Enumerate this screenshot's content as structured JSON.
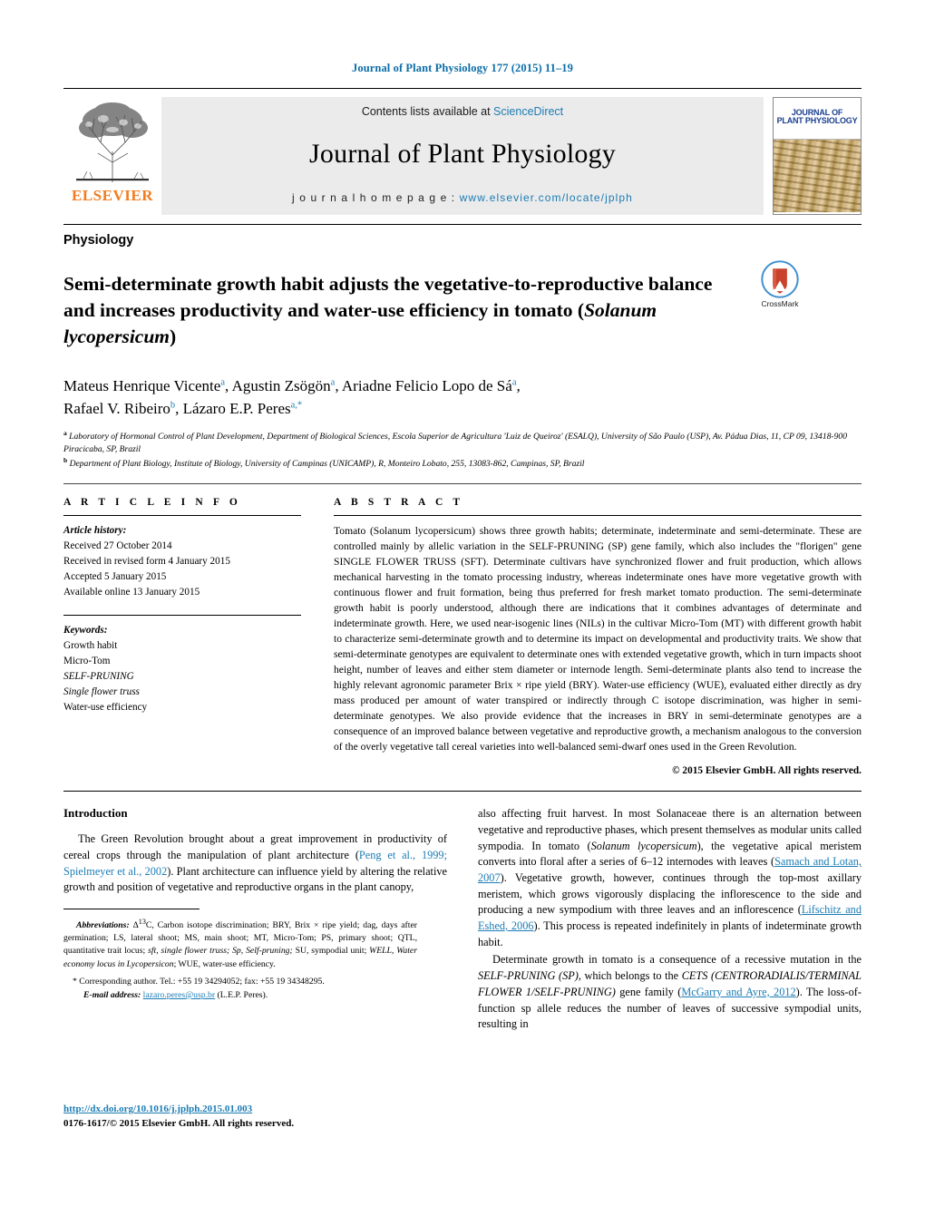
{
  "running_head": "Journal of Plant Physiology 177 (2015) 11–19",
  "masthead": {
    "contents_prefix": "Contents lists available at ",
    "sciencedirect": "ScienceDirect",
    "journal_name": "Journal of Plant Physiology",
    "homepage_prefix": "j o u r n a l   h o m e p a g e :   ",
    "homepage_url": "www.elsevier.com/locate/jplph",
    "publisher": "ELSEVIER",
    "cover_title_line1": "JOURNAL OF",
    "cover_title_line2": "PLANT PHYSIOLOGY"
  },
  "article": {
    "section_label": "Physiology",
    "title_part1": "Semi-determinate growth habit adjusts the vegetative-to-reproductive balance and increases productivity and water-use efficiency in tomato (",
    "title_italic": "Solanum lycopersicum",
    "title_part2": ")",
    "crossmark_label": "CrossMark",
    "authors": "Mateus Henrique Vicente a, Agustin Zsögön a, Ariadne Felicio Lopo de Sá a, Rafael V. Ribeiro b, Lázaro E.P. Peres a,*",
    "affiliation_a": "Laboratory of Hormonal Control of Plant Development, Department of Biological Sciences, Escola Superior de Agricultura 'Luiz de Queiroz' (ESALQ), University of São Paulo (USP), Av. Pádua Dias, 11, CP 09, 13418-900 Piracicaba, SP, Brazil",
    "affiliation_b": "Department of Plant Biology, Institute of Biology, University of Campinas (UNICAMP), R, Monteiro Lobato, 255, 13083-862, Campinas, SP, Brazil"
  },
  "article_info": {
    "heading": "A R T I C L E   I N F O",
    "history_label": "Article history:",
    "history": [
      "Received 27 October 2014",
      "Received in revised form 4 January 2015",
      "Accepted 5 January 2015",
      "Available online 13 January 2015"
    ],
    "keywords_label": "Keywords:",
    "keywords": [
      "Growth habit",
      "Micro-Tom",
      "SELF-PRUNING",
      "Single flower truss",
      "Water-use efficiency"
    ]
  },
  "abstract": {
    "heading": "A B S T R A C T",
    "text": "Tomato (Solanum lycopersicum) shows three growth habits; determinate, indeterminate and semi-determinate. These are controlled mainly by allelic variation in the SELF-PRUNING (SP) gene family, which also includes the \"florigen\" gene SINGLE FLOWER TRUSS (SFT). Determinate cultivars have synchronized flower and fruit production, which allows mechanical harvesting in the tomato processing industry, whereas indeterminate ones have more vegetative growth with continuous flower and fruit formation, being thus preferred for fresh market tomato production. The semi-determinate growth habit is poorly understood, although there are indications that it combines advantages of determinate and indeterminate growth. Here, we used near-isogenic lines (NILs) in the cultivar Micro-Tom (MT) with different growth habit to characterize semi-determinate growth and to determine its impact on developmental and productivity traits. We show that semi-determinate genotypes are equivalent to determinate ones with extended vegetative growth, which in turn impacts shoot height, number of leaves and either stem diameter or internode length. Semi-determinate plants also tend to increase the highly relevant agronomic parameter Brix × ripe yield (BRY). Water-use efficiency (WUE), evaluated either directly as dry mass produced per amount of water transpired or indirectly through C isotope discrimination, was higher in semi-determinate genotypes. We also provide evidence that the increases in BRY in semi-determinate genotypes are a consequence of an improved balance between vegetative and reproductive growth, a mechanism analogous to the conversion of the overly vegetative tall cereal varieties into well-balanced semi-dwarf ones used in the Green Revolution.",
    "copyright": "© 2015 Elsevier GmbH. All rights reserved."
  },
  "introduction": {
    "heading": "Introduction",
    "left_para1_a": "The Green Revolution brought about a great improvement in productivity of cereal crops through the manipulation of plant architecture (",
    "left_para1_cite": "Peng et al., 1999; Spielmeyer et al., 2002",
    "left_para1_b": "). Plant architecture can influence yield by altering the relative growth and position of vegetative and reproductive organs in the plant canopy,",
    "right_para1_a": "also affecting fruit harvest. In most Solanaceae there is an alternation between vegetative and reproductive phases, which present themselves as modular units called sympodia. In tomato (",
    "right_para1_italic1": "Solanum lycopersicum",
    "right_para1_b": "), the vegetative apical meristem converts into floral after a series of 6–12 internodes with leaves (",
    "right_para1_cite1": "Samach and Lotan, 2007",
    "right_para1_c": "). Vegetative growth, however, continues through the top-most axillary meristem, which grows vigorously displacing the inflorescence to the side and producing a new sympodium with three leaves and an inflorescence (",
    "right_para1_cite2": "Lifschitz and Eshed, 2006",
    "right_para1_d": "). This process is repeated indefinitely in plants of indeterminate growth habit.",
    "right_para2_a": "Determinate growth in tomato is a consequence of a recessive mutation in the ",
    "right_para2_italic1": "SELF-PRUNING (SP)",
    "right_para2_b": ", which belongs to the ",
    "right_para2_italic2": "CETS (CENTRORADIALIS/TERMINAL FLOWER 1/SELF-PRUNING)",
    "right_para2_c": " gene family (",
    "right_para2_cite": "McGarry and Ayre, 2012",
    "right_para2_d": "). The loss-of-function sp allele reduces the number of leaves of successive sympodial units, resulting in"
  },
  "footnotes": {
    "abbrev_label": "Abbreviations:",
    "abbrev_text": " Δ13C, Carbon isotope discrimination; BRY, Brix × ripe yield; dag, days after germination; LS, lateral shoot; MS, main shoot; MT, Micro-Tom; PS, primary shoot; QTL, quantitative trait locus; sft, single flower truss; Sp, Self-pruning; SU, sympodial unit; WELL, Water economy locus in Lycopersicon; WUE, water-use efficiency.",
    "corresponding": "* Corresponding author. Tel.: +55 19 34294052; fax: +55 19 34348295.",
    "email_label": "E-mail address:",
    "email": "lazaro.peres@usp.br",
    "email_suffix": " (L.E.P. Peres)."
  },
  "footer": {
    "doi": "http://dx.doi.org/10.1016/j.jplph.2015.01.003",
    "issn_line": "0176-1617/© 2015 Elsevier GmbH. All rights reserved."
  },
  "colors": {
    "link": "#1b7cb5",
    "elsevier_orange": "#F47C20",
    "header_blue": "#0b6ea8"
  }
}
